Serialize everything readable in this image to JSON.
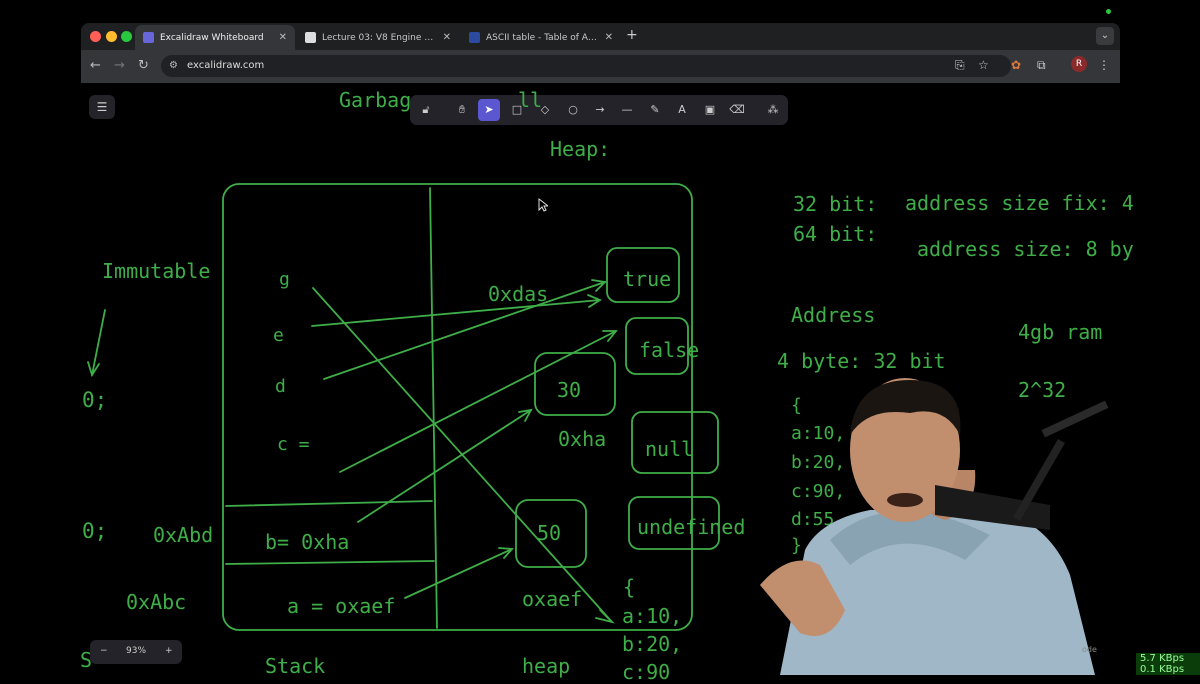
{
  "browser": {
    "tabs": [
      {
        "title": "Excalidraw Whiteboard",
        "active": true
      },
      {
        "title": "Lecture 03: V8 Engine (Memo",
        "active": false
      },
      {
        "title": "ASCII table - Table of ASCII c",
        "active": false
      }
    ],
    "url": "excalidraw.com",
    "profile_initial": "R"
  },
  "toolbar": {
    "tools": [
      "lock-icon",
      "hand-icon",
      "selection-icon",
      "rectangle-icon",
      "diamond-icon",
      "ellipse-icon",
      "arrow-icon",
      "line-icon",
      "draw-icon",
      "text-icon",
      "image-icon",
      "eraser-icon",
      "extra-tools-icon"
    ],
    "selected": "selection-icon"
  },
  "zoom": {
    "minus": "−",
    "value": "93%",
    "plus": "+"
  },
  "canvas": {
    "title_partial": "Garbag",
    "title_suffix": "ll",
    "heap_label": "Heap:",
    "immutable": "Immutable",
    "left_zero1": "0;",
    "left_zero2": "0;",
    "left_s": "S",
    "addr_abd": "0xAbd",
    "addr_abc": "0xAbc",
    "stack_vars": {
      "g": "g",
      "e": "e",
      "d": "d",
      "c": "c =",
      "b": "b=  0xha",
      "a": "a = oxaef"
    },
    "oxdas": "0xdas",
    "oxha": "0xha",
    "oxaef": "oxaef",
    "heap_values": {
      "true": "true",
      "false": "false",
      "v30": "30",
      "null": "null",
      "v50": "50",
      "undefined": "undefined"
    },
    "obj_open": "{",
    "obj_a": "a:10,",
    "obj_b": "b:20,",
    "obj_c_partial": "c:90",
    "stack_label": "Stack",
    "heap_label_bottom": "heap",
    "bit32": "32 bit:",
    "bit64": "64 bit:",
    "addr_fix": "address size fix: 4",
    "addr_size8": "address size: 8 by",
    "address": "Address",
    "ram": "4gb ram",
    "byte32": "4 byte: 32 bit",
    "pow": "2^32",
    "r_open": "{",
    "r_a": "a:10,",
    "r_b": "b:20,",
    "r_c": "c:90,",
    "r_d": "d:55",
    "r_close": "}"
  },
  "overlay": {
    "mode_text": "ode",
    "net_down": "5.7 KBps",
    "net_up": "0.1 KBps"
  },
  "colors": {
    "ink": "#3fae49",
    "toolbar_bg": "#232329",
    "selected_tool": "#5b57d1",
    "canvas_bg": "#000000"
  }
}
